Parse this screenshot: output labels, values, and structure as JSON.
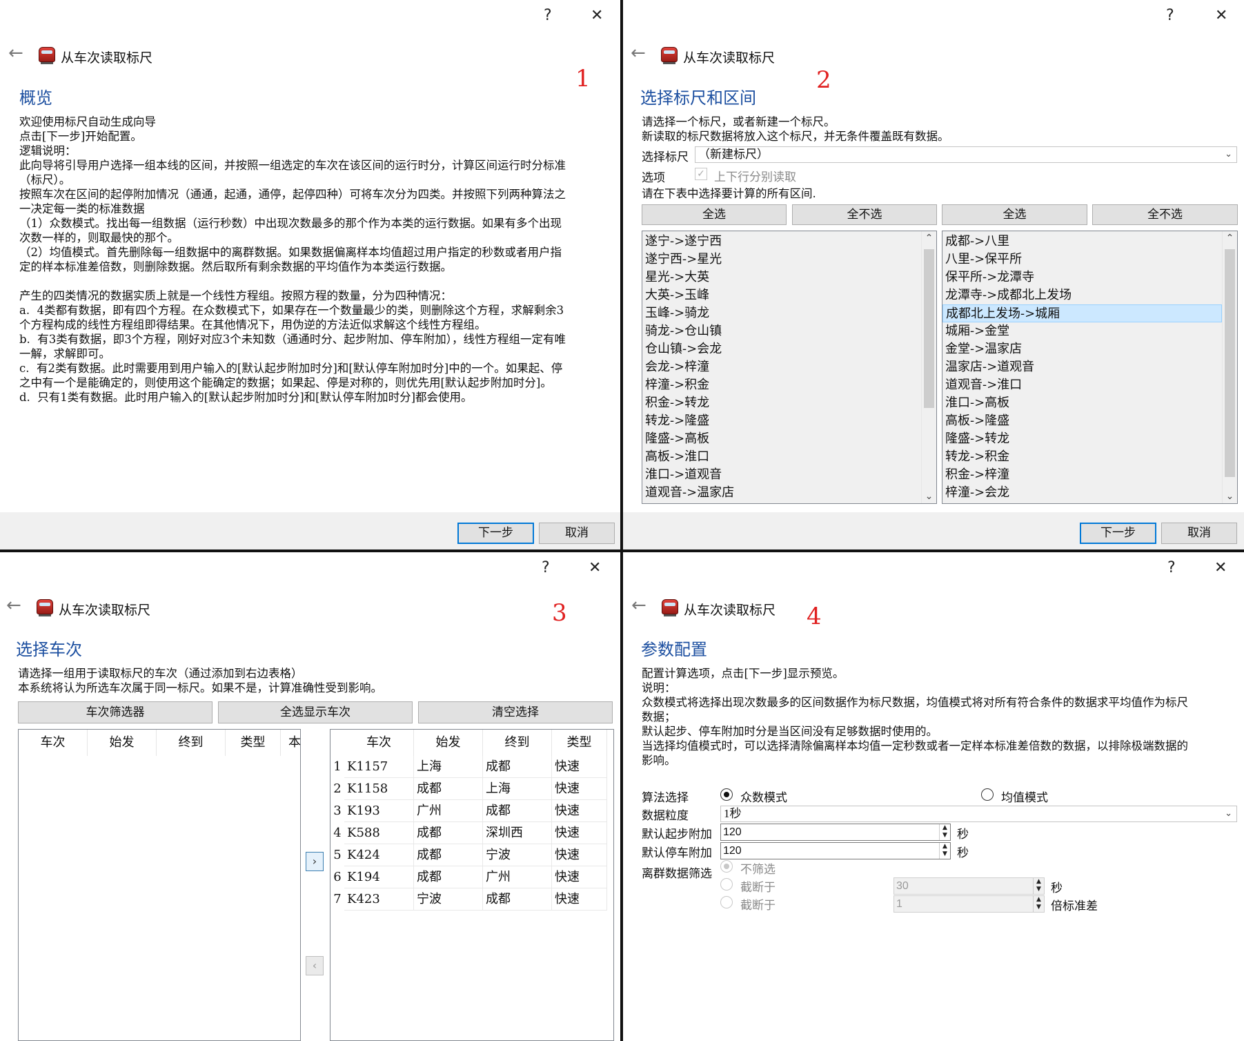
{
  "window_title": "从车次读取标尺",
  "help_glyph": "?",
  "close_glyph": "✕",
  "back_glyph": "←",
  "panel1": {
    "number": "1",
    "heading": "概览",
    "body": "欢迎使用标尺自动生成向导\n点击[下一步]开始配置。\n逻辑说明：\n此向导将引导用户选择一组本线的区间，并按照一组选定的车次在该区间的运行时分，计算区间运行时分标准\n（标尺）。\n按照车次在区间的起停附加情况（通通，起通，通停，起停四种）可将车次分为四类。并按照下列两种算法之\n一决定每一类的标准数据\n（1）众数模式。找出每一组数据（运行秒数）中出现次数最多的那个作为本类的运行数据。如果有多个出现\n次数一样的，则取最快的那个。\n（2）均值模式。首先删除每一组数据中的离群数据。如果数据偏离样本均值超过用户指定的秒数或者用户指\n定的样本标准差倍数，则删除数据。然后取所有剩余数据的平均值作为本类运行数据。\n\n产生的四类情况的数据实质上就是一个线性方程组。按照方程的数量，分为四种情况：\na.  4类都有数据，即有四个方程。在众数模式下，如果存在一个数量最少的类，则删除这个方程，求解剩余3\n个方程构成的线性方程组即得结果。在其他情况下，用伪逆的方法近似求解这个线性方程组。\nb.  有3类有数据，即3个方程，刚好对应3个未知数（通通时分、起步附加、停车附加），线性方程组一定有唯\n一解，求解即可。\nc.  有2类有数据。此时需要用到用户输入的[默认起步附加时分]和[默认停车附加时分]中的一个。如果起、停\n之中有一个是能确定的，则使用这个能确定的数据；如果起、停是对称的，则优先用[默认起步附加时分]。\nd.  只有1类有数据。此时用户输入的[默认起步附加时分]和[默认停车附加时分]都会使用。",
    "next": "下一步",
    "cancel": "取消"
  },
  "panel2": {
    "number": "2",
    "heading": "选择标尺和区间",
    "intro": "请选择一个标尺，或者新建一个标尺。\n新读取的标尺数据将放入这个标尺，并无条件覆盖既有数据。",
    "ruler_label": "选择标尺",
    "ruler_value": "（新建标尺）",
    "option_label": "选项",
    "option_check": "上下行分别读取",
    "table_hint": "请在下表中选择要计算的所有区间.",
    "select_all": "全选",
    "select_none": "全不选",
    "left_list": [
      "遂宁->遂宁西",
      "遂宁西->星光",
      "星光->大英",
      "大英->玉峰",
      "玉峰->骑龙",
      "骑龙->仓山镇",
      "仓山镇->会龙",
      "会龙->梓潼",
      "梓潼->积金",
      "积金->转龙",
      "转龙->隆盛",
      "隆盛->高板",
      "高板->淮口",
      "淮口->道观音",
      "道观音->温家店"
    ],
    "right_list": [
      "成都->八里",
      "八里->保平所",
      "保平所->龙潭寺",
      "龙潭寺->成都北上发场",
      "成都北上发场->城厢",
      "城厢->金堂",
      "金堂->温家店",
      "温家店->道观音",
      "道观音->淮口",
      "淮口->高板",
      "高板->隆盛",
      "隆盛->转龙",
      "转龙->积金",
      "积金->梓潼",
      "梓潼->会龙"
    ],
    "right_selected_index": 4,
    "next": "下一步",
    "cancel": "取消"
  },
  "panel3": {
    "number": "3",
    "heading": "选择车次",
    "intro": "请选择一组用于读取标尺的车次（通过添加到右边表格）\n本系统将认为所选车次属于同一标尺。如果不是，计算准确性受到影响。",
    "btn_filter": "车次筛选器",
    "btn_select_all": "全选显示车次",
    "btn_clear": "清空选择",
    "left_headers": [
      "车次",
      "始发",
      "终到",
      "类型",
      "本"
    ],
    "right_headers": [
      "车次",
      "始发",
      "终到",
      "类型"
    ],
    "add_glyph": "›",
    "remove_glyph": "‹",
    "rows": [
      {
        "n": "1",
        "train": "K1157",
        "from": "上海",
        "to": "成都",
        "type": "快速"
      },
      {
        "n": "2",
        "train": "K1158",
        "from": "成都",
        "to": "上海",
        "type": "快速"
      },
      {
        "n": "3",
        "train": "K193",
        "from": "广州",
        "to": "成都",
        "type": "快速"
      },
      {
        "n": "4",
        "train": "K588",
        "from": "成都",
        "to": "深圳西",
        "type": "快速"
      },
      {
        "n": "5",
        "train": "K424",
        "from": "成都",
        "to": "宁波",
        "type": "快速"
      },
      {
        "n": "6",
        "train": "K194",
        "from": "成都",
        "to": "广州",
        "type": "快速"
      },
      {
        "n": "7",
        "train": "K423",
        "from": "宁波",
        "to": "成都",
        "type": "快速"
      }
    ]
  },
  "panel4": {
    "number": "4",
    "heading": "参数配置",
    "intro": "配置计算选项，点击[下一步]显示预览。\n说明：\n众数模式将选择出现次数最多的区间数据作为标尺数据，均值模式将对所有符合条件的数据求平均值作为标尺\n数据；\n默认起步、停车附加时分是当区间没有足够数据时使用的。\n当选择均值模式时，可以选择清除偏离样本均值一定秒数或者一定样本标准差倍数的数据，以排除极端数据的\n影响。",
    "algo_label": "算法选择",
    "algo_mode": "众数模式",
    "algo_mean": "均值模式",
    "gran_label": "数据粒度",
    "gran_value": "1秒",
    "start_label": "默认起步附加",
    "start_value": "120",
    "stop_label": "默认停车附加",
    "stop_value": "120",
    "sec_unit": "秒",
    "filter_label": "离群数据筛选",
    "no_filter": "不筛选",
    "cut1": "截断于",
    "cut1_value": "30",
    "cut1_unit": "秒",
    "cut2": "截断于",
    "cut2_value": "1",
    "cut2_unit": "倍标准差"
  }
}
